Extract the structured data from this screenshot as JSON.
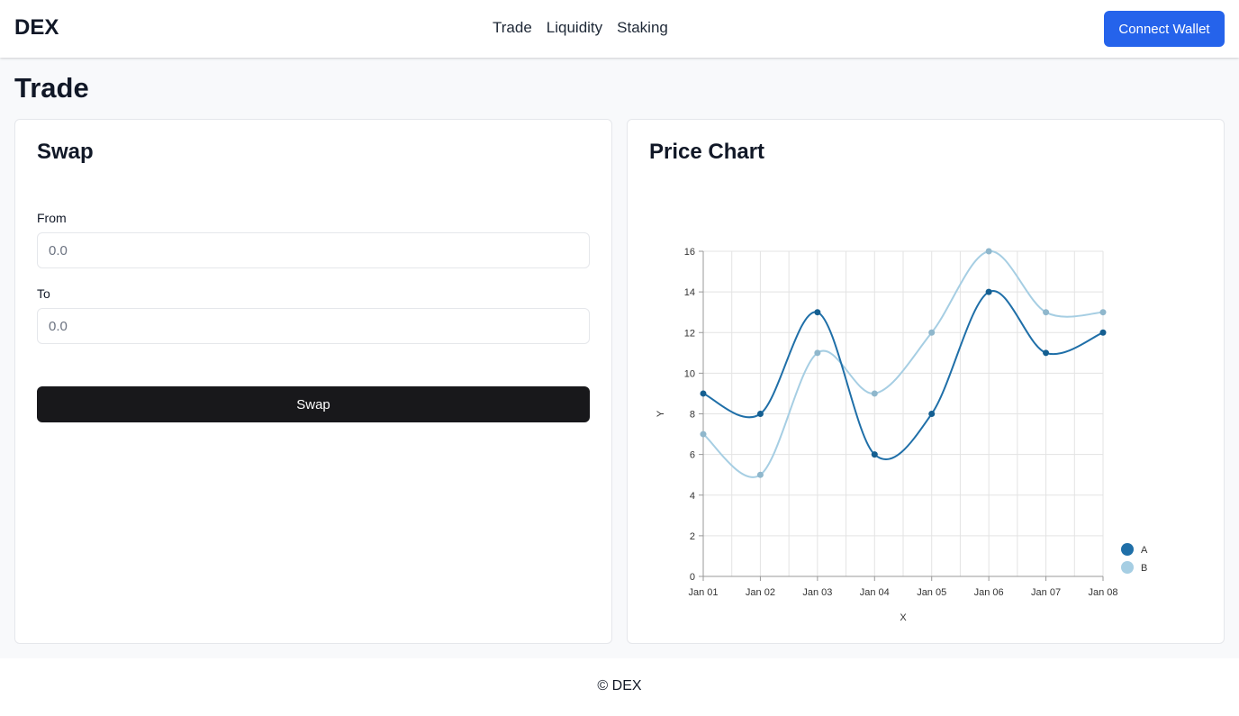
{
  "header": {
    "logo": "DEX",
    "nav": [
      "Trade",
      "Liquidity",
      "Staking"
    ],
    "connect_label": "Connect Wallet"
  },
  "page": {
    "title": "Trade"
  },
  "swap": {
    "title": "Swap",
    "from_label": "From",
    "from_placeholder": "0.0",
    "to_label": "To",
    "to_placeholder": "0.0",
    "button_label": "Swap"
  },
  "chart_card": {
    "title": "Price Chart"
  },
  "chart_data": {
    "type": "line",
    "categories": [
      "Jan 01",
      "Jan 02",
      "Jan 03",
      "Jan 04",
      "Jan 05",
      "Jan 06",
      "Jan 07",
      "Jan 08"
    ],
    "series": [
      {
        "name": "A",
        "values": [
          9,
          8,
          13,
          6,
          8,
          14,
          11,
          12
        ],
        "color": "#1f6fa8"
      },
      {
        "name": "B",
        "values": [
          7,
          5,
          11,
          9,
          12,
          16,
          13,
          13
        ],
        "color": "#a6cee3"
      }
    ],
    "xlabel": "X",
    "ylabel": "Y",
    "ylim": [
      0,
      16
    ],
    "yticks": [
      0,
      2,
      4,
      6,
      8,
      10,
      12,
      14,
      16
    ],
    "grid": true,
    "legend": "bottom-right"
  },
  "footer": {
    "text": "© DEX"
  }
}
